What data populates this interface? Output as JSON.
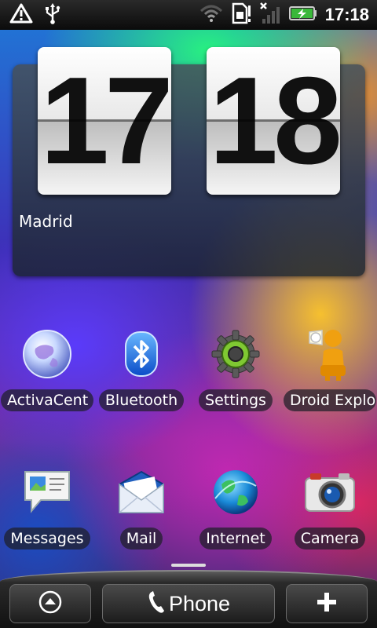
{
  "status_bar": {
    "time": "17:18",
    "left_icons": [
      "warning-icon",
      "usb-icon"
    ],
    "right_icons": [
      "wifi-icon",
      "sim-icon",
      "signal-icon",
      "battery-charging-icon"
    ]
  },
  "clock_widget": {
    "hours": "17",
    "minutes": "18",
    "city": "Madrid"
  },
  "apps": [
    {
      "label": "ActivaCent",
      "icon": "globe-orb-icon"
    },
    {
      "label": "Bluetooth",
      "icon": "bluetooth-icon"
    },
    {
      "label": "Settings",
      "icon": "gear-icon"
    },
    {
      "label": "Droid Explo",
      "icon": "droid-explorer-icon"
    },
    {
      "label": "Messages",
      "icon": "messages-icon"
    },
    {
      "label": "Mail",
      "icon": "mail-icon"
    },
    {
      "label": "Internet",
      "icon": "internet-globe-icon"
    },
    {
      "label": "Camera",
      "icon": "camera-icon"
    }
  ],
  "dock": {
    "phone_label": "Phone",
    "left_icon": "up-arrow-icon",
    "right_icon": "plus-icon"
  }
}
